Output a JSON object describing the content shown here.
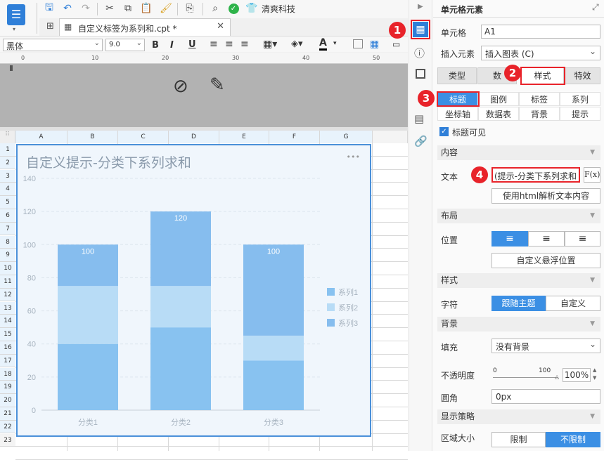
{
  "toolbar": {
    "brand": "清爽科技"
  },
  "tab": {
    "title": "自定义标签为系列和.cpt *"
  },
  "format": {
    "font": "黑体",
    "size": "9.0"
  },
  "columns": [
    "A",
    "B",
    "C",
    "D",
    "E",
    "F",
    "G"
  ],
  "rows": [
    "1",
    "2",
    "3",
    "4",
    "5",
    "6",
    "7",
    "8",
    "9",
    "10",
    "11",
    "12",
    "13",
    "14",
    "15",
    "16",
    "17",
    "18",
    "19",
    "20",
    "21",
    "22",
    "23"
  ],
  "chart": {
    "title": "自定义提示-分类下系列求和",
    "menu": "•••"
  },
  "chart_data": {
    "type": "bar",
    "stacked": true,
    "categories": [
      "分类1",
      "分类2",
      "分类3"
    ],
    "series": [
      {
        "name": "系列1",
        "values": [
          40,
          50,
          30
        ],
        "color": "#88c2f0"
      },
      {
        "name": "系列2",
        "values": [
          35,
          25,
          15
        ],
        "color": "#b8dcf6"
      },
      {
        "name": "系列3",
        "values": [
          25,
          45,
          55
        ],
        "color": "#86bdee"
      }
    ],
    "totals": [
      "100",
      "120",
      "100"
    ],
    "yticks": [
      "0",
      "20",
      "40",
      "60",
      "80",
      "100",
      "120",
      "140"
    ],
    "ylim": [
      0,
      140
    ],
    "legend": "right"
  },
  "panel": {
    "title": "单元格元素",
    "cell_label": "单元格",
    "cell_value": "A1",
    "insert_label": "插入元素",
    "insert_value": "插入图表 (C)",
    "tabs": [
      "类型",
      "数",
      "样式",
      "特效"
    ],
    "subtabs": [
      "标题",
      "图例",
      "标签",
      "系列",
      "坐标轴",
      "数据表",
      "背景",
      "提示"
    ],
    "title_visible": "标题可见",
    "content_section": "内容",
    "text_label": "文本",
    "text_value": "(提示-分类下系列求和",
    "fx": "F(x)",
    "html_btn": "使用html解析文本内容",
    "layout_section": "布局",
    "position_label": "位置",
    "float_btn": "自定义悬浮位置",
    "style_section": "样式",
    "char_label": "字符",
    "follow_theme": "跟随主题",
    "custom": "自定义",
    "bg_section": "背景",
    "fill_label": "填充",
    "fill_value": "没有背景",
    "opacity_label": "不透明度",
    "opacity_min": "0",
    "opacity_max": "100",
    "opacity_value": "100%",
    "radius_label": "圆角",
    "radius_value": "0px",
    "display_section": "显示策略",
    "area_label": "区域大小",
    "limit": "限制",
    "nolimit": "不限制"
  },
  "badges": [
    "1",
    "2",
    "3",
    "4"
  ]
}
